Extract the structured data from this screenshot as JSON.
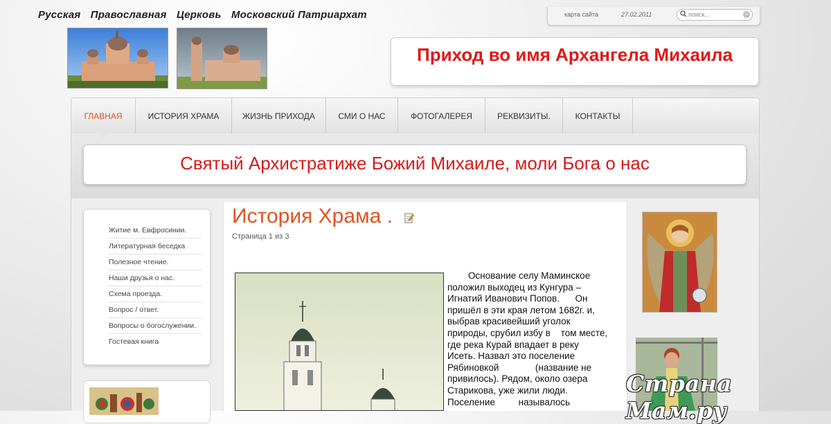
{
  "header": {
    "church_name": [
      "Русская",
      "Православная",
      "Церковь",
      "Московский Патриархат"
    ],
    "site_title": "Приход во имя Архангела Михаила",
    "sitemap_label": "карта сайта",
    "date": "27.02.2011",
    "search_placeholder": "поиск..."
  },
  "nav": {
    "items": [
      {
        "label": "ГЛАВНАЯ",
        "active": true
      },
      {
        "label": "ИСТОРИЯ ХРАМА"
      },
      {
        "label": "ЖИЗНЬ ПРИХОДА"
      },
      {
        "label": "СМИ О НАС"
      },
      {
        "label": "ФОТОГАЛЕРЕЯ"
      },
      {
        "label": "РЕКВИЗИТЫ."
      },
      {
        "label": "КОНТАКТЫ"
      }
    ]
  },
  "banner": {
    "text": "Святый Архистратиже Божий Михаиле, моли Бога о нас"
  },
  "sidebar": {
    "items": [
      "Житие м. Евфросинии.",
      "Литературная беседка",
      "Полезное чтение.",
      "Наши друзья о нас.",
      "Схема проезда.",
      "Вопрос / ответ.",
      "Вопросы о богослужении.",
      "Гостевая книга"
    ]
  },
  "article": {
    "title": "История Храма .",
    "page_info": "Страница 1 из 3",
    "lines": [
      "        Основание селу Маминское",
      "положил выходец из Кунгура –",
      "Игнатий Иванович Попов.      Он",
      "пришёл в эти края летом 1682г. и,",
      "выбрав красивейший уголок",
      "природы, срубил избу в    том месте,",
      "где река Курай впадает в реку",
      "Исеть. Назвал это поселение",
      "Рябиновкой              (название не",
      "привилось). Рядом, около озера",
      "Старикова, уже жили люди.",
      "Поселение         называлось"
    ]
  },
  "watermark": "Страна Мам.ру",
  "icons": {
    "search": "search-icon",
    "clear": "clear-icon",
    "edit": "edit-icon"
  },
  "colors": {
    "accent": "#e0531f",
    "title_red": "#e01818"
  }
}
